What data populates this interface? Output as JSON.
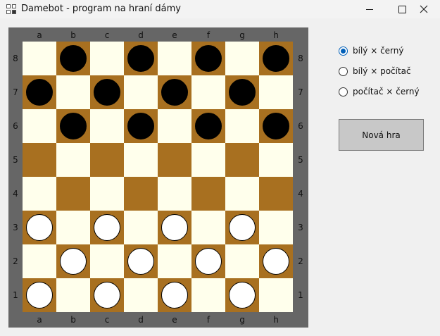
{
  "window": {
    "title": "Damebot - program na hraní dámy",
    "icon": "window-app-icon"
  },
  "board": {
    "columns": [
      "a",
      "b",
      "c",
      "d",
      "e",
      "f",
      "g",
      "h"
    ],
    "rows": [
      "8",
      "7",
      "6",
      "5",
      "4",
      "3",
      "2",
      "1"
    ],
    "colors": {
      "frame": "#666666",
      "light": "#ffffec",
      "dark": "#a87020"
    },
    "squares": [
      [
        null,
        "black",
        null,
        "black",
        null,
        "black",
        null,
        "black"
      ],
      [
        "black",
        null,
        "black",
        null,
        "black",
        null,
        "black",
        null
      ],
      [
        null,
        "black",
        null,
        "black",
        null,
        "black",
        null,
        "black"
      ],
      [
        null,
        null,
        null,
        null,
        null,
        null,
        null,
        null
      ],
      [
        null,
        null,
        null,
        null,
        null,
        null,
        null,
        null
      ],
      [
        "white",
        null,
        "white",
        null,
        "white",
        null,
        "white",
        null
      ],
      [
        null,
        "white",
        null,
        "white",
        null,
        "white",
        null,
        "white"
      ],
      [
        "white",
        null,
        "white",
        null,
        "white",
        null,
        "white",
        null
      ]
    ]
  },
  "mode_options": [
    {
      "label": "bílý × černý",
      "checked": true
    },
    {
      "label": "bílý × počítač",
      "checked": false
    },
    {
      "label": "počítač × černý",
      "checked": false
    }
  ],
  "new_game_label": "Nová hra",
  "accent_color": "#005fb8"
}
